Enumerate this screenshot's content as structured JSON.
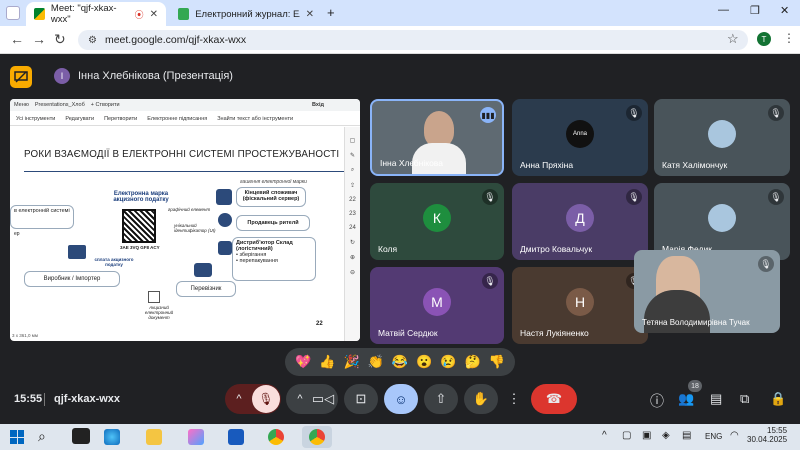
{
  "browser": {
    "tabs": [
      {
        "title": "Meet: \"qjf-xkax-wxx\"",
        "active": true
      },
      {
        "title": "Електронний журнал: Електро",
        "active": false
      }
    ],
    "new_tab": "+",
    "url": "meet.google.com/qjf-xkax-wxx",
    "profile_initial": "T"
  },
  "meet": {
    "presenter_initial": "І",
    "presenter_title": "Інна Хлебнікова (Презентація)",
    "time": "15:55",
    "meeting_code": "qjf-xkax-wxx",
    "participants_count": "18"
  },
  "shared_screen": {
    "toolbar": {
      "menu": "Меню",
      "file_tab": "Presentations_Хлоб",
      "create": "+ Створити",
      "login": "Вхід",
      "tools": [
        "Усі інструменти",
        "Редагувати",
        "Перетворити",
        "Електронне підписання",
        "Знайти текст або інструменти"
      ]
    },
    "slide": {
      "title": "РОКИ ВЗАЄМОДІЇ В ЕЛЕКТРОННІ СИСТЕМІ ПРОСТЕЖУВАНОСТІ",
      "top_caption": "гашення електронної марки",
      "center_title": "Електронна марка акцизного податку",
      "graphic_element": "графічний елемент",
      "unique_id": "унікальний ідентифікатор (UI)",
      "code_text": "3AE 3VQ GF8 ACY",
      "left_box": "в електронній системі",
      "left_small": "ер",
      "payment": "сплата акцизного податку",
      "producer": "Виробник / Імпортер",
      "carrier": "Перевізник",
      "doc": "Акцизний електронний документ",
      "consumer": "Кінцевий споживач (фіскальний сервер)",
      "retail": "Продавець рителй",
      "distributor": "Дистриб'ютор Склад (логістичний)",
      "bullets": [
        "зберігання",
        "перепакування"
      ],
      "page_num": "22",
      "zoom": "3 x 361,0 мм",
      "side_nums": [
        "22",
        "23",
        "24"
      ]
    }
  },
  "participants": [
    {
      "name": "Інна Хлєбнікова",
      "speaking": true
    },
    {
      "name": "Анна Пряхіна",
      "avatar_text": "Anna"
    },
    {
      "name": "Катя Халімончук"
    },
    {
      "name": "Коля",
      "initial": "К",
      "color": "#1e8e3e"
    },
    {
      "name": "Дмитро Ковальчук",
      "initial": "Д",
      "color": "#7b5ea7"
    },
    {
      "name": "Марія Федик"
    },
    {
      "name": "Матвій Сердюк",
      "initial": "М",
      "color": "#8a53b5"
    },
    {
      "name": "Настя Лукіяненко",
      "initial": "Н",
      "color": "#7a5a47"
    },
    {
      "name": "Тетяна Володимирівна Тучак"
    }
  ],
  "reactions": [
    "💖",
    "👍",
    "🎉",
    "👏",
    "😂",
    "😮",
    "😢",
    "🤔",
    "👎"
  ],
  "taskbar": {
    "lang": "ENG",
    "time": "15:55",
    "date": "30.04.2025"
  }
}
